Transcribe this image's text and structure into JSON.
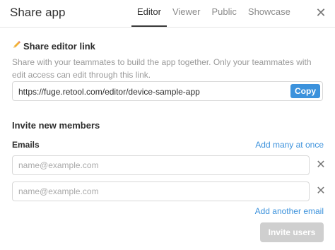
{
  "header": {
    "title": "Share app",
    "tabs": [
      {
        "label": "Editor",
        "active": true
      },
      {
        "label": "Viewer",
        "active": false
      },
      {
        "label": "Public",
        "active": false
      },
      {
        "label": "Showcase",
        "active": false
      }
    ],
    "close_icon": "close-icon"
  },
  "editor_link": {
    "heading": "Share editor link",
    "icon": "pencil-icon",
    "description": "Share with your teammates to build the app together. Only your teammates with edit access can edit through this link.",
    "url": "https://fuge.retool.com/editor/device-sample-app",
    "copy_label": "Copy"
  },
  "invite": {
    "heading": "Invite new members",
    "emails_label": "Emails",
    "add_many_label": "Add many at once",
    "email_placeholder": "name@example.com",
    "email_rows": [
      {
        "value": "",
        "placeholder": "name@example.com"
      },
      {
        "value": "",
        "placeholder": "name@example.com"
      }
    ],
    "add_another_label": "Add another email",
    "invite_button_label": "Invite users",
    "invite_button_disabled": true
  },
  "colors": {
    "accent": "#3c92dc",
    "disabled_button": "#cfcfcf"
  }
}
